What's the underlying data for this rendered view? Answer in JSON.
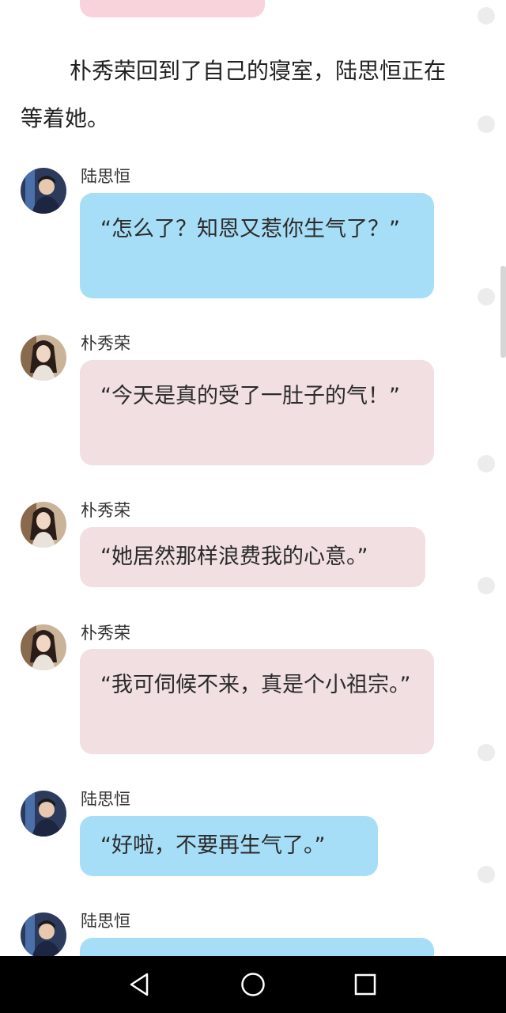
{
  "narration": "朴秀荣回到了自己的寝室，陆思恒正在等着她。",
  "messages": [
    {
      "name": "陆思恒",
      "text": "“怎么了？知恩又惹你生气了？”"
    },
    {
      "name": "朴秀荣",
      "text": "“今天是真的受了一肚子的气！”"
    },
    {
      "name": "朴秀荣",
      "text": "“她居然那样浪费我的心意。”"
    },
    {
      "name": "朴秀荣",
      "text": "“我可伺候不来，真是个小祖宗。”"
    },
    {
      "name": "陆思恒",
      "text": "“好啦，不要再生气了。”"
    },
    {
      "name": "陆思恒",
      "text": ""
    }
  ],
  "colors": {
    "boy_bubble": "#a7def7",
    "girl_bubble": "#f1dfe1",
    "top_bubble": "#f9d3dc"
  },
  "navbar": {
    "icons": [
      "back-triangle-icon",
      "home-circle-icon",
      "recents-square-icon"
    ]
  }
}
